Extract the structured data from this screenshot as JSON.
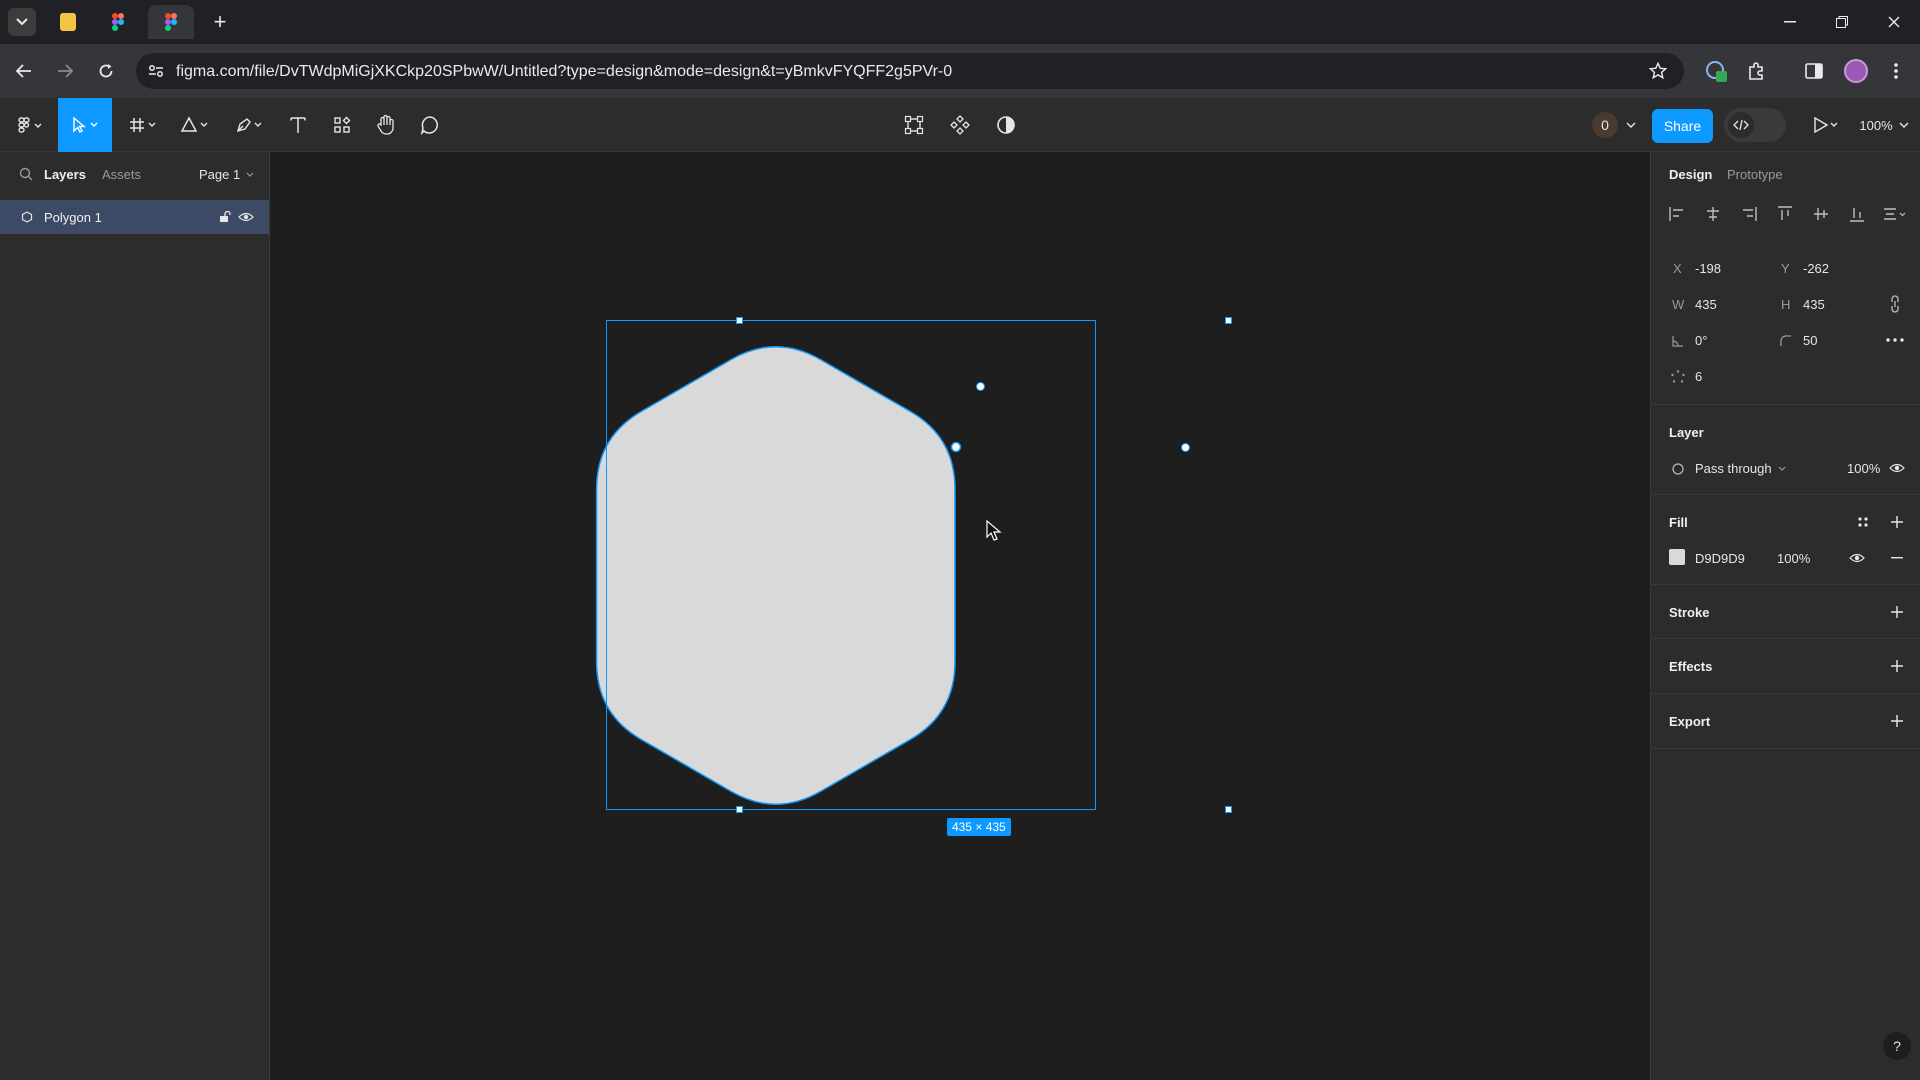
{
  "browser": {
    "url": "figma.com/file/DvTWdpMiGjXKCkp20SPbwW/Untitled?type=design&mode=design&t=yBmkvFYQFF2g5PVr-0",
    "new_tab_symbol": "+"
  },
  "toolbar": {
    "share_label": "Share",
    "zoom": "100%",
    "avatar_count": "0"
  },
  "left_panel": {
    "tabs": [
      "Layers",
      "Assets"
    ],
    "page": "Page 1",
    "layers": [
      {
        "name": "Polygon 1"
      }
    ]
  },
  "canvas": {
    "size_badge": "435 × 435",
    "shape_fill": "#D9D9D9",
    "selection_color": "#0D99FF"
  },
  "right_panel": {
    "tabs": [
      "Design",
      "Prototype"
    ],
    "x_label": "X",
    "x": "-198",
    "y_label": "Y",
    "y": "-262",
    "w_label": "W",
    "w": "435",
    "h_label": "H",
    "h": "435",
    "rotation": "0°",
    "corner_radius": "50",
    "count": "6",
    "layer": {
      "title": "Layer",
      "blend": "Pass through",
      "opacity": "100%"
    },
    "fill": {
      "title": "Fill",
      "hex": "D9D9D9",
      "opacity": "100%"
    },
    "stroke_title": "Stroke",
    "effects_title": "Effects",
    "export_title": "Export"
  },
  "help_label": "?"
}
